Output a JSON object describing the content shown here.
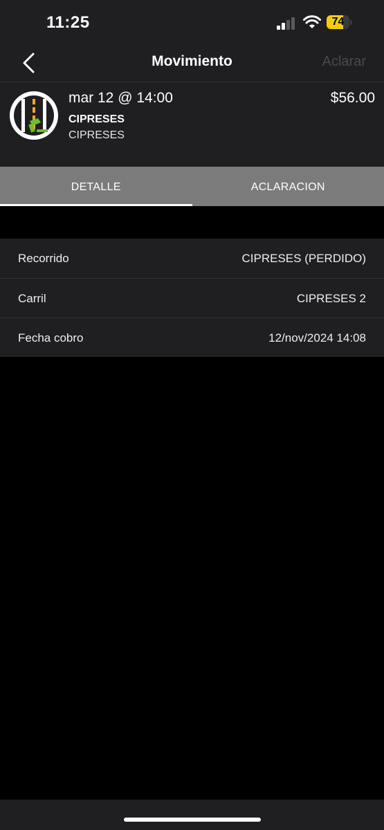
{
  "status_bar": {
    "time": "11:25",
    "battery": "74",
    "battery_level": 0.74
  },
  "nav": {
    "title": "Movimiento",
    "action_label": "Aclarar",
    "back_icon": "chevron-left-icon"
  },
  "summary": {
    "date": "mar 12 @ 14:00",
    "amount": "$56.00",
    "place": "CIPRESES",
    "subplace": "CIPRESES",
    "logo_icon": "toll-road-icon"
  },
  "tabs": [
    {
      "label": "DETALLE",
      "active": true
    },
    {
      "label": "ACLARACION",
      "active": false
    }
  ],
  "details": [
    {
      "label": "Recorrido",
      "value": "CIPRESES (PERDIDO)"
    },
    {
      "label": "Carril",
      "value": "CIPRESES 2"
    },
    {
      "label": "Fecha cobro",
      "value": "12/nov/2024 14:08"
    }
  ],
  "colors": {
    "accent_green": "#6cbf2f",
    "lane_yellow": "#f5a623",
    "battery_yellow": "#f2cc0d"
  }
}
